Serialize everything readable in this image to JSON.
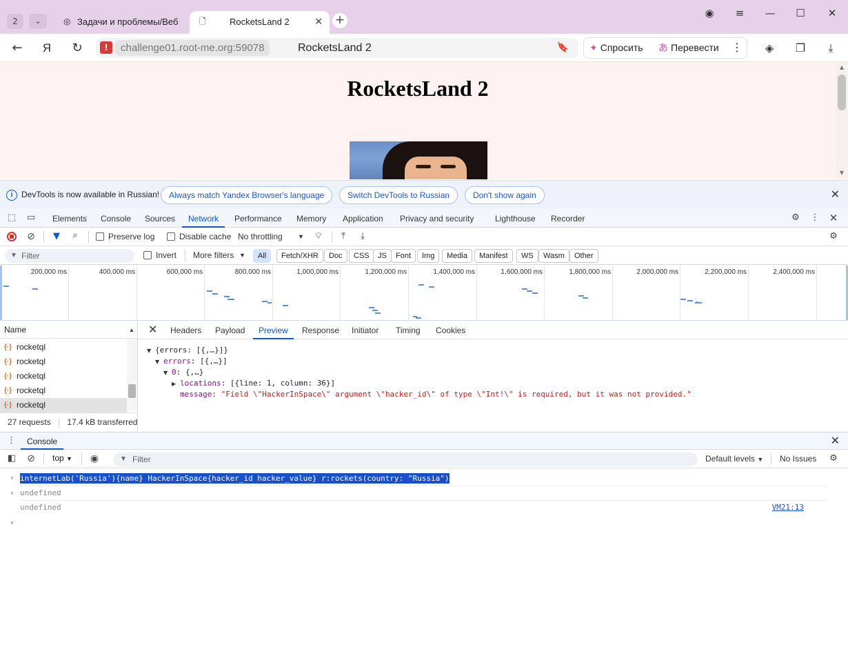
{
  "browser": {
    "tab_count": "2",
    "tabs": [
      {
        "label": "Задачи и проблемы/Веб"
      },
      {
        "label": "RocketsLand 2"
      }
    ],
    "address": {
      "host": "challenge01.root-me.org:59078",
      "title": "RocketsLand 2"
    },
    "ai_buttons": {
      "ask": "Спросить",
      "translate": "Перевести"
    }
  },
  "page": {
    "heading": "RocketsLand 2",
    "background": "#fff3f1"
  },
  "devtools": {
    "infobar": {
      "text": "DevTools is now available in Russian!",
      "btn_match": "Always match Yandex Browser's language",
      "btn_switch": "Switch DevTools to Russian",
      "btn_dont_show": "Don't show again"
    },
    "panels": [
      "Elements",
      "Console",
      "Sources",
      "Network",
      "Performance",
      "Memory",
      "Application",
      "Privacy and security",
      "Lighthouse",
      "Recorder"
    ],
    "selected_panel": "Network",
    "network_toolbar": {
      "preserve_log": "Preserve log",
      "disable_cache": "Disable cache",
      "throttling": "No throttling"
    },
    "filter": {
      "placeholder": "Filter",
      "invert": "Invert",
      "more_filters": "More filters",
      "chips": [
        "All",
        "Fetch/XHR",
        "Doc",
        "CSS",
        "JS",
        "Font",
        "Img",
        "Media",
        "Manifest",
        "WS",
        "Wasm",
        "Other"
      ],
      "selected_chip": "All"
    },
    "overview_ticks": [
      "200,000 ms",
      "400,000 ms",
      "600,000 ms",
      "800,000 ms",
      "1,000,000 ms",
      "1,200,000 ms",
      "1,400,000 ms",
      "1,600,000 ms",
      "1,800,000 ms",
      "2,000,000 ms",
      "2,200,000 ms",
      "2,400,000 ms"
    ],
    "requests": {
      "header": "Name",
      "rows": [
        "rocketql",
        "rocketql",
        "rocketql",
        "rocketql",
        "rocketql"
      ],
      "status_count": "27 requests",
      "status_transferred": "17.4 kB transferred"
    },
    "detail_tabs": [
      "Headers",
      "Payload",
      "Preview",
      "Response",
      "Initiator",
      "Timing",
      "Cookies"
    ],
    "selected_detail_tab": "Preview",
    "preview": {
      "root": "{errors: [{,…}]}",
      "errors_key": "errors",
      "errors_val": "[{,…}]",
      "item_key": "0",
      "item_val": "{,…}",
      "locations_key": "locations",
      "locations_val": "[{line: 1, column: 36}]",
      "message_key": "message",
      "message_val": "\"Field \\\"HackerInSpace\\\" argument \\\"hacker_id\\\" of type \\\"Int!\\\" is required, but it was not provided.\""
    },
    "drawer": {
      "tab": "Console",
      "context": "top",
      "filter_placeholder": "Filter",
      "levels": "Default levels",
      "issues": "No Issues",
      "lines": {
        "input": "internetLab('Russia'){name} HackerInSpace{hacker_id hacker_value} r:rockets(country: \"Russia\")",
        "result": "undefined",
        "log": "undefined",
        "log_source": "VM21:13"
      }
    }
  }
}
